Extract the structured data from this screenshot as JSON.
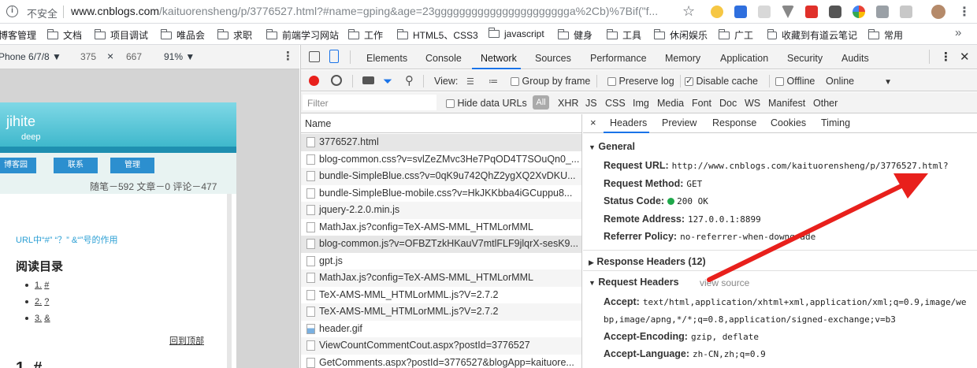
{
  "address_bar": {
    "insecure_label": "不安全",
    "url_host": "www.cnblogs.com",
    "url_rest": "/kaituorensheng/p/3776527.html?#name=gping&age=23gggggggggggggggggggggga%2Cb)%7Bif(\"f..."
  },
  "bookmarks": [
    "博客管理",
    "文档",
    "项目调试",
    "唯品会",
    "求职",
    "前端学习网站",
    "工作",
    "HTML5、CSS3",
    "javascript",
    "健身",
    "工具",
    "休闲娱乐",
    "广工",
    "收藏到有道云笔记",
    "常用"
  ],
  "device_toolbar": {
    "device": "Phone 6/7/8 ▼",
    "width": "375",
    "times": "×",
    "height": "667",
    "zoom": "91% ▼"
  },
  "page": {
    "blog_title": "jihite",
    "blog_subtitle": "deep",
    "nav": [
      "博客园",
      "联系",
      "管理"
    ],
    "stats": "随笔－592  文章－0  评论－477",
    "article_title": "URL中“#” “？” &“”号的作用",
    "toc_heading": "阅读目录",
    "toc": [
      {
        "num": "1.",
        "text": "#"
      },
      {
        "num": "2.",
        "text": "?"
      },
      {
        "num": "3.",
        "text": "&"
      }
    ],
    "back_to_top": "回到顶部",
    "section_heading": "1. #"
  },
  "devtools": {
    "tabs": [
      "Elements",
      "Console",
      "Network",
      "Sources",
      "Performance",
      "Memory",
      "Application",
      "Security",
      "Audits"
    ],
    "active_tab": "Network",
    "toolbar": {
      "view_label": "View:",
      "group_by_frame": "Group by frame",
      "preserve_log": "Preserve log",
      "disable_cache": "Disable cache",
      "offline": "Offline",
      "online": "Online"
    },
    "filter": {
      "placeholder": "Filter",
      "hide_data_urls": "Hide data URLs",
      "types": [
        "All",
        "XHR",
        "JS",
        "CSS",
        "Img",
        "Media",
        "Font",
        "Doc",
        "WS",
        "Manifest",
        "Other"
      ]
    },
    "list_header": "Name",
    "requests": [
      "3776527.html",
      "blog-common.css?v=svlZeZMvc3He7PqOD4T7SOuQn0_...",
      "bundle-SimpleBlue.css?v=0qK9u742QhZ2ygXQ2XvDKU...",
      "bundle-SimpleBlue-mobile.css?v=HkJKKbba4iGCuppu8...",
      "jquery-2.2.0.min.js",
      "MathJax.js?config=TeX-AMS-MML_HTMLorMML",
      "blog-common.js?v=OFBZTzkHKauV7mtlFLF9jlqrX-sesK9...",
      "gpt.js",
      "MathJax.js?config=TeX-AMS-MML_HTMLorMML",
      "TeX-AMS-MML_HTMLorMML.js?V=2.7.2",
      "TeX-AMS-MML_HTMLorMML.js?V=2.7.2",
      "header.gif",
      "ViewCountCommentCout.aspx?postId=3776527",
      "GetComments.aspx?postId=3776527&blogApp=kaituore..."
    ],
    "detail_tabs": [
      "Headers",
      "Preview",
      "Response",
      "Cookies",
      "Timing"
    ],
    "general_title": "General",
    "general": [
      {
        "k": "Request URL:",
        "v": "http://www.cnblogs.com/kaituorensheng/p/3776527.html?"
      },
      {
        "k": "Request Method:",
        "v": "GET"
      },
      {
        "k": "Status Code:",
        "v": "200 OK"
      },
      {
        "k": "Remote Address:",
        "v": "127.0.0.1:8899"
      },
      {
        "k": "Referrer Policy:",
        "v": "no-referrer-when-downgrade"
      }
    ],
    "response_headers_title": "Response Headers (12)",
    "request_headers_title": "Request Headers",
    "view_source": "view source",
    "accept_key": "Accept:",
    "accept_val_1": "text/html,application/xhtml+xml,application/xml;q=0.9,image/we",
    "accept_val_2": "bp,image/apng,*/*;q=0.8,application/signed-exchange;v=b3",
    "accept_encoding_key": "Accept-Encoding:",
    "accept_encoding_val": "gzip, deflate",
    "accept_language_key": "Accept-Language:",
    "accept_language_val": "zh-CN,zh;q=0.9"
  },
  "colors": {
    "accent": "#1a73e8",
    "arrow": "#e8201c",
    "status_ok": "#1fa84a",
    "banner": "#3fb8cc"
  }
}
